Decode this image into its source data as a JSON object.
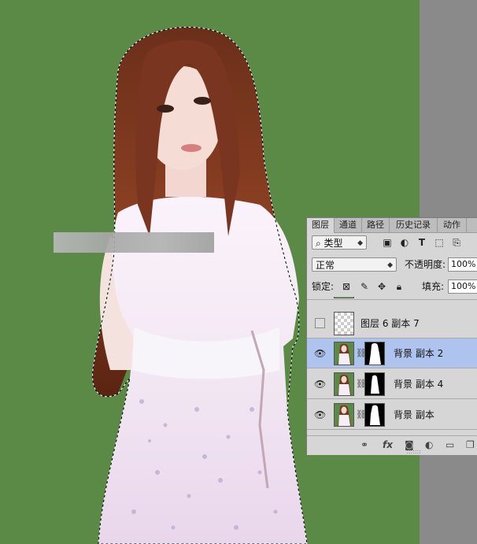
{
  "panel": {
    "tabs": [
      {
        "label": "图层",
        "active": true
      },
      {
        "label": "通道",
        "active": false
      },
      {
        "label": "路径",
        "active": false
      },
      {
        "label": "历史记录",
        "active": false
      },
      {
        "label": "动作",
        "active": false
      }
    ],
    "filter": {
      "icon": "search-icon",
      "label": "类型"
    },
    "blend_mode": "正常",
    "opacity_label": "不透明度:",
    "opacity_value": "100%",
    "lock_label": "锁定:",
    "fill_label": "填充:",
    "fill_value": "100%",
    "layers": [
      {
        "name": "图层 6 副本 7",
        "visible": false,
        "thumb": "transparent",
        "has_mask": false,
        "selected": false
      },
      {
        "name": "背景 副本 2",
        "visible": true,
        "thumb": "photo",
        "has_mask": true,
        "selected": true
      },
      {
        "name": "背景 副本 4",
        "visible": true,
        "thumb": "photo",
        "has_mask": true,
        "selected": false
      },
      {
        "name": "背景 副本",
        "visible": true,
        "thumb": "photo",
        "has_mask": true,
        "selected": false
      }
    ],
    "bottom_icons": [
      "link-icon",
      "fx-icon",
      "add-mask-icon",
      "adjustment-icon",
      "folder-icon",
      "new-layer-icon"
    ]
  },
  "colors": {
    "canvas_bg": "#5a8a45",
    "panel_bg": "#d6d6d6",
    "selection": "#aec4ee"
  }
}
